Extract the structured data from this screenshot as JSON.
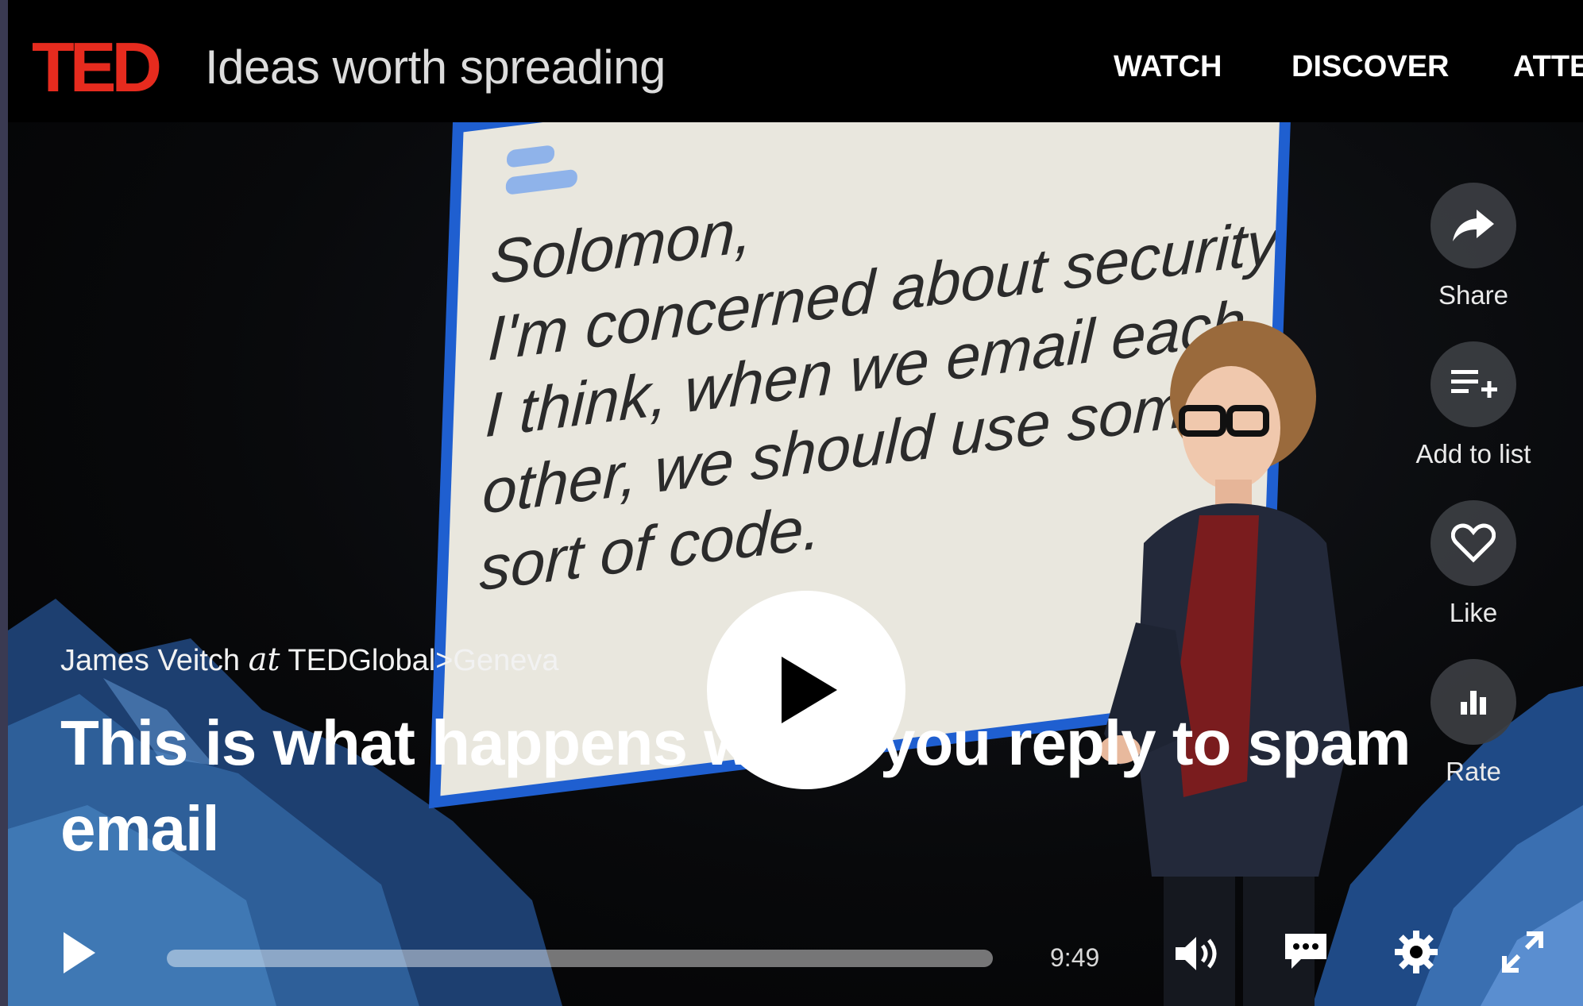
{
  "header": {
    "logo": "TED",
    "tagline": "Ideas worth spreading",
    "nav": [
      "WATCH",
      "DISCOVER",
      "ATTE"
    ]
  },
  "slide": {
    "lines": [
      "Solomon,",
      "I'm concerned about security;",
      "I think, when we email each",
      "other, we should use some",
      "sort of code."
    ]
  },
  "talk": {
    "speaker": "James Veitch",
    "at_word": "at",
    "event": "TEDGlobal>Geneva",
    "title": "This is what happens when you reply to spam email"
  },
  "actions": {
    "share": "Share",
    "add_to_list": "Add to list",
    "like": "Like",
    "rate": "Rate"
  },
  "player": {
    "duration": "9:49",
    "progress": 0
  },
  "colors": {
    "brand_red": "#e62b1e",
    "screen_blue": "#1f5fd0"
  },
  "icons": [
    "play-icon",
    "share-icon",
    "add-to-list-icon",
    "heart-icon",
    "rate-bars-icon",
    "volume-icon",
    "captions-icon",
    "settings-gear-icon",
    "fullscreen-icon"
  ]
}
